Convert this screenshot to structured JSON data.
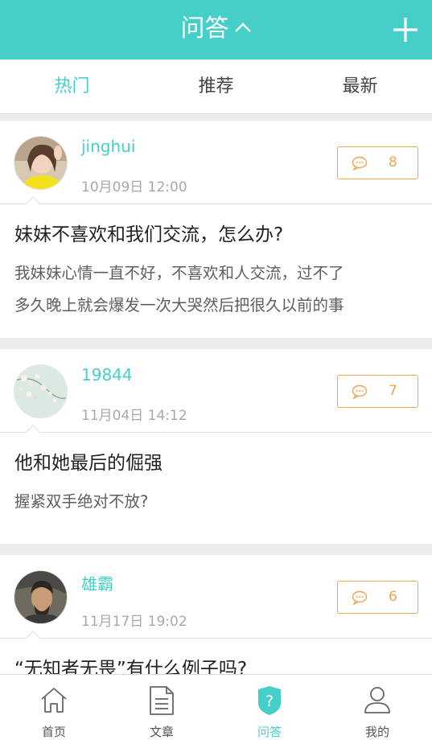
{
  "header": {
    "title": "问答",
    "accent_color": "#46cfc9"
  },
  "tabs": [
    {
      "label": "热门",
      "active": true
    },
    {
      "label": "推荐",
      "active": false
    },
    {
      "label": "最新",
      "active": false
    }
  ],
  "posts": [
    {
      "username": "jinghui",
      "time": "10月09日 12:00",
      "comment_count": "8",
      "title": "妹妹不喜欢和我们交流，怎么办?",
      "body_lines": [
        "我妹妹心情一直不好，不喜欢和人交流，过不了",
        "多久晚上就会爆发一次大哭然后把很久以前的事"
      ]
    },
    {
      "username": "19844",
      "time": "11月04日 14:12",
      "comment_count": "7",
      "title": "他和她最后的倔强",
      "body_lines": [
        "握紧双手绝对不放?"
      ]
    },
    {
      "username": "雄霸",
      "time": "11月17日 19:02",
      "comment_count": "6",
      "title": "“无知者无畏”有什么例子吗?",
      "body_lines": []
    }
  ],
  "bottom_nav": [
    {
      "label": "首页",
      "icon": "home-icon",
      "active": false
    },
    {
      "label": "文章",
      "icon": "article-icon",
      "active": false
    },
    {
      "label": "问答",
      "icon": "question-shield-icon",
      "active": true
    },
    {
      "label": "我的",
      "icon": "profile-icon",
      "active": false
    }
  ],
  "colors": {
    "accent": "#46cfc9",
    "comment_orange": "#f2a54a"
  }
}
